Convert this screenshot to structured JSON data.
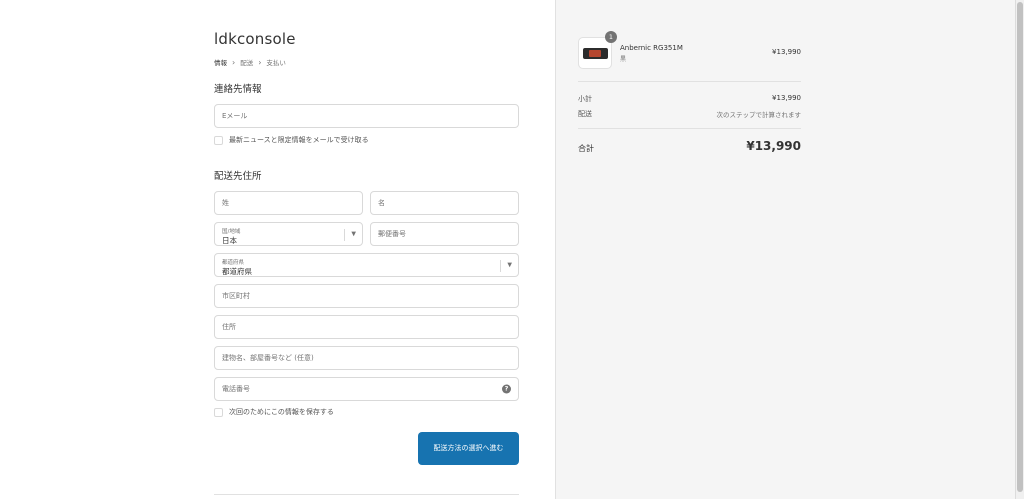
{
  "store": {
    "name": "ldkconsole"
  },
  "breadcrumb": {
    "items": [
      "情報",
      "配送",
      "支払い"
    ],
    "separator": "›"
  },
  "contact": {
    "title": "連絡先情報",
    "email_placeholder": "Eメール",
    "newsletter_label": "最新ニュースと限定情報をメールで受け取る"
  },
  "shipping": {
    "title": "配送先住所",
    "last_name_placeholder": "姓",
    "first_name_placeholder": "名",
    "country_label": "国/地域",
    "country_value": "日本",
    "postal_placeholder": "郵便番号",
    "prefecture_label": "都道府県",
    "prefecture_value": "都道府県",
    "city_placeholder": "市区町村",
    "address_placeholder": "住所",
    "building_placeholder": "建物名、部屋番号など (任意)",
    "phone_placeholder": "電話番号",
    "help_glyph": "?",
    "save_info_label": "次回のためにこの情報を保存する",
    "submit_label": "配送方法の選択へ進む"
  },
  "summary": {
    "product": {
      "quantity": "1",
      "name": "Anbernic RG351M",
      "variant": "黒",
      "price": "¥13,990"
    },
    "subtotal_label": "小計",
    "subtotal_value": "¥13,990",
    "shipping_label": "配送",
    "shipping_value": "次のステップで計算されます",
    "total_label": "合計",
    "total_value": "¥13,990"
  },
  "icons": {
    "select_caret": "chevron-down-icon",
    "help": "question-circle-icon"
  },
  "colors": {
    "primary_button": "#1773b0",
    "sidebar_bg": "#f5f5f5"
  }
}
